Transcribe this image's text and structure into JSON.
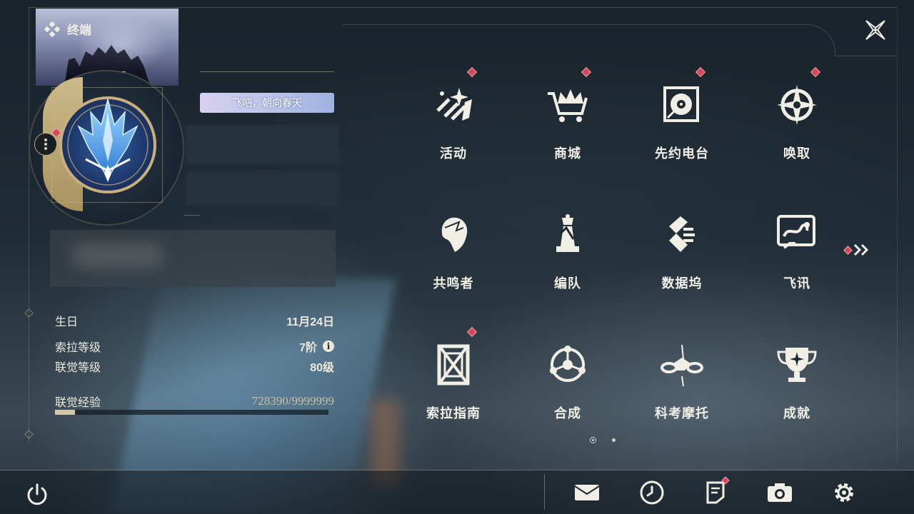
{
  "header": {
    "title": "终端"
  },
  "profile": {
    "card_banner": "参 ○",
    "signature": "飞吧，朝向春天"
  },
  "stats": {
    "birthday_label": "生日",
    "birthday_value": "11月24日",
    "sola_level_label": "索拉等级",
    "sola_level_value": "7阶",
    "union_level_label": "联觉等级",
    "union_level_value": "80级",
    "union_exp_label": "联觉经验",
    "union_exp_value": "728390/9999999",
    "union_exp_progress": 0.0728
  },
  "menu": {
    "items": [
      {
        "label": "活动",
        "icon": "sparkle-icon",
        "badge": true
      },
      {
        "label": "商城",
        "icon": "cart-crown-icon",
        "badge": true
      },
      {
        "label": "先约电台",
        "icon": "radio-icon",
        "badge": true
      },
      {
        "label": "唤取",
        "icon": "compass-star-icon",
        "badge": true
      },
      {
        "label": "共鸣者",
        "icon": "character-head-icon",
        "badge": false
      },
      {
        "label": "编队",
        "icon": "chess-icon",
        "badge": false
      },
      {
        "label": "数据坞",
        "icon": "data-dock-icon",
        "badge": false
      },
      {
        "label": "飞讯",
        "icon": "chat-icon",
        "badge": false
      },
      {
        "label": "索拉指南",
        "icon": "guide-book-icon",
        "badge": true
      },
      {
        "label": "合成",
        "icon": "synthesis-icon",
        "badge": false
      },
      {
        "label": "科考摩托",
        "icon": "motorcycle-icon",
        "badge": false
      },
      {
        "label": "成就",
        "icon": "trophy-icon",
        "badge": false
      }
    ],
    "pages_total": 2,
    "current_page": 1
  },
  "bottom_bar": {
    "buttons": [
      "power-icon",
      "mail-icon",
      "clock-icon",
      "notice-icon",
      "camera-icon",
      "settings-icon"
    ],
    "notice_badge": true
  },
  "colors": {
    "accent_gold": "#cdb98a",
    "badge_red": "#d6485a",
    "text_light": "#f1eee6"
  }
}
